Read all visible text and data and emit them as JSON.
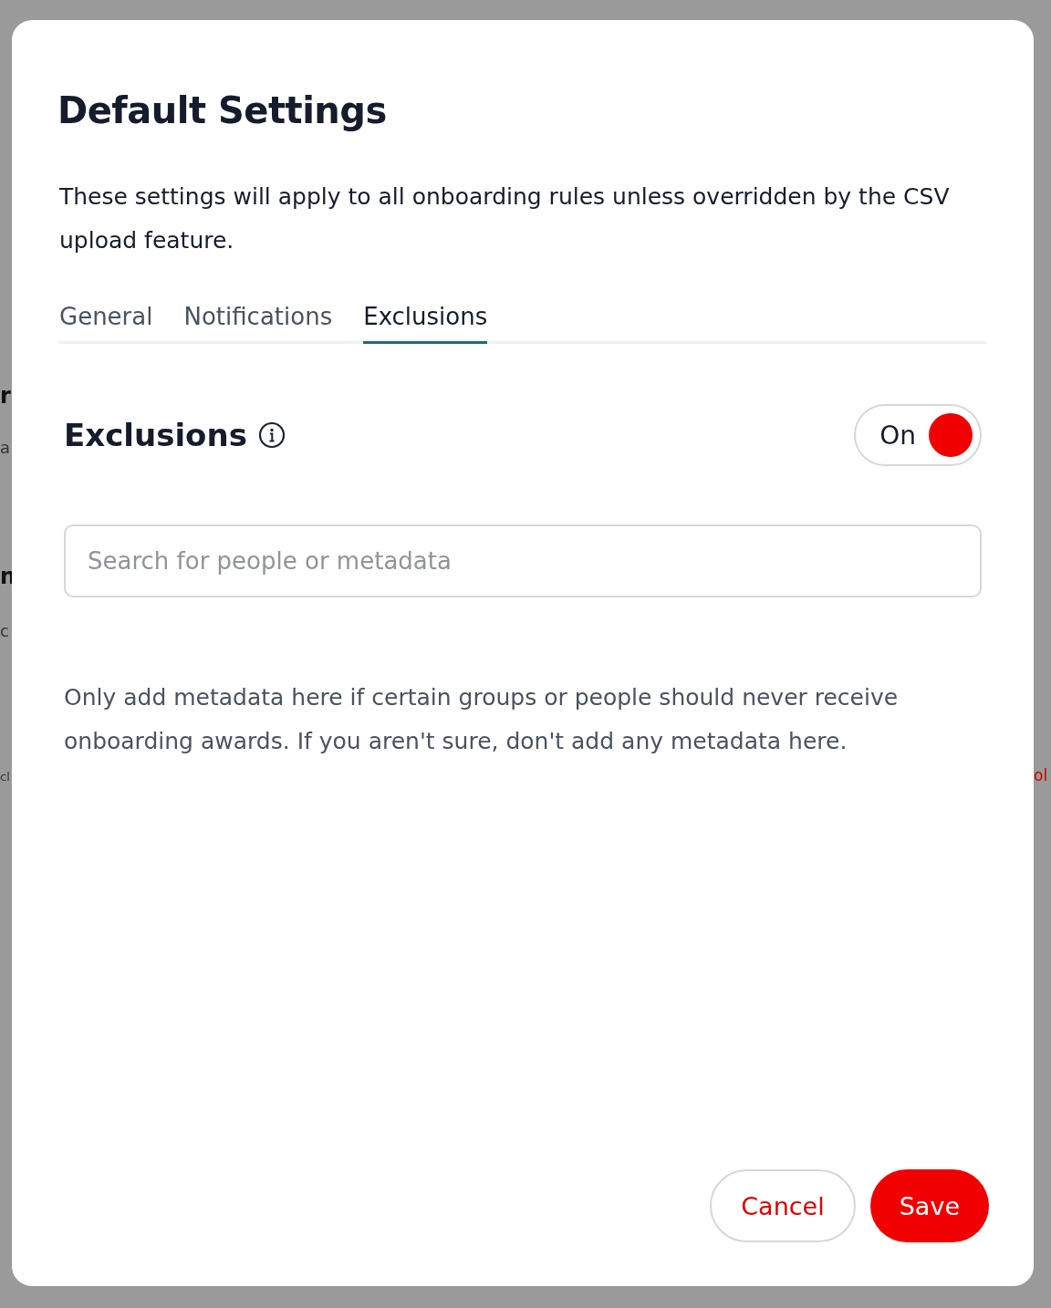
{
  "backdrop": {
    "left_fragments": [
      {
        "text": "r",
        "kind": "heading"
      },
      {
        "text": "a",
        "kind": "body"
      },
      {
        "text": "n",
        "kind": "heading"
      },
      {
        "text": "c",
        "kind": "body"
      },
      {
        "text": "cl",
        "kind": "body"
      }
    ],
    "right_fragments": [
      {
        "text": "ol",
        "kind": "link"
      }
    ]
  },
  "dialog": {
    "title": "Default Settings",
    "description": "These settings will apply to all onboarding rules unless overridden by the CSV upload feature.",
    "tabs": [
      {
        "label": "General",
        "selected": false
      },
      {
        "label": "Notifications",
        "selected": false
      },
      {
        "label": "Exclusions",
        "selected": true
      }
    ],
    "section": {
      "heading": "Exclusions",
      "toggle": {
        "label": "On",
        "on": true
      },
      "search": {
        "placeholder": "Search for people or metadata"
      },
      "help": "Only add metadata here if certain groups or people should never receive onboarding awards. If you aren't sure, don't add any metadata here."
    },
    "buttons": [
      {
        "label": "Cancel",
        "kind": "secondary"
      },
      {
        "label": "Save",
        "kind": "primary"
      }
    ]
  }
}
